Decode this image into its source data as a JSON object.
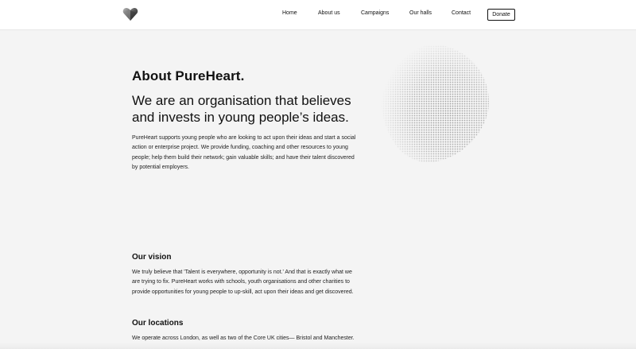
{
  "nav": {
    "logo_icon": "heart-logo-icon",
    "items": [
      {
        "label": "Home"
      },
      {
        "label": "About us"
      },
      {
        "label": "Campaigns"
      },
      {
        "label": "Our halls"
      },
      {
        "label": "Contact"
      }
    ],
    "donate_label": "Donate"
  },
  "about": {
    "title": "About PureHeart.",
    "headline": "We are an organisation that believes and invests in young people’s ideas.",
    "intro": "PureHeart supports young people who are looking to act upon their ideas and start a social action or enterprise project. We provide funding, coaching and other resources to young people; help them build their network; gain valuable skills; and have their talent discovered by potential employers."
  },
  "vision": {
    "title": "Our vision",
    "body": "We truly believe that 'Talent is everywhere, opportunity is not.' And that is exactly what we are trying to fix. PureHeart works with schools, youth organisations and other charities to provide opportunities for young people to up-skill, act upon their ideas and get discovered."
  },
  "locations": {
    "title": "Our locations",
    "body": "We operate across London, as well as two of the Core UK cities— Bristol and Manchester."
  },
  "decor": {
    "blob_icon": "halftone-blob-graphic",
    "accent": "#111111",
    "background": "#f4f4f4"
  }
}
